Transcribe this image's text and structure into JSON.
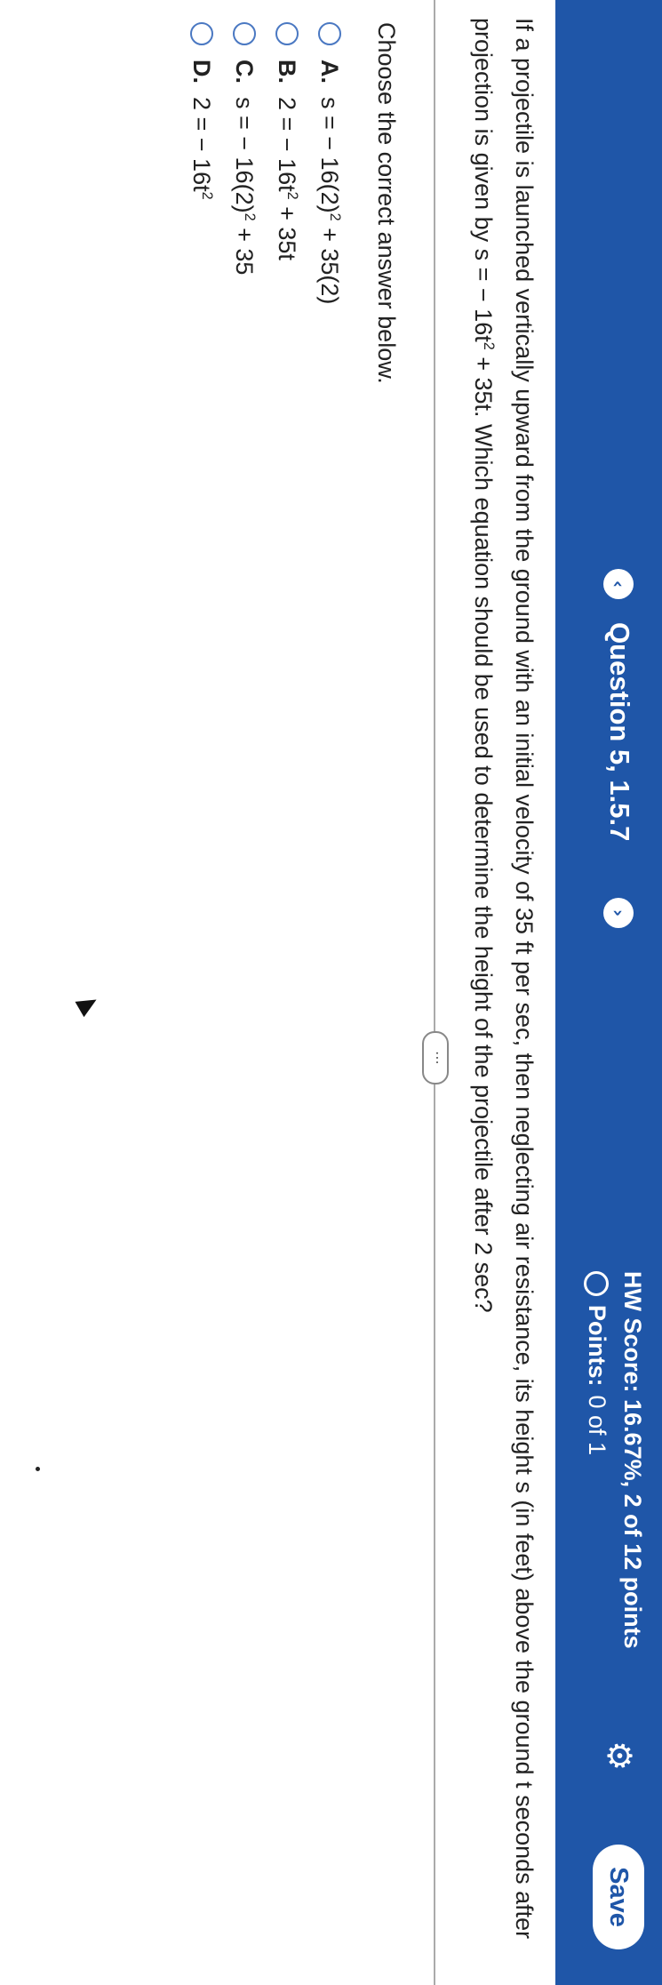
{
  "header": {
    "question_title": "Question 5, 1.5.7",
    "prev_icon": "‹",
    "next_icon": "›",
    "hw_score": "HW Score: 16.67%, 2 of 12 points",
    "points_label": "Points:",
    "points_value": "0 of 1",
    "save_label": "Save",
    "gear_icon": "⚙"
  },
  "question": {
    "text_a": "If a projectile is launched vertically upward from the ground with an initial velocity of 35 ft per sec, then neglecting air resistance, its height s (in feet) above the ground t seconds after projection is given by s = − 16t",
    "text_exp": "2",
    "text_b": " + 35t. Which equation should be used to determine the height of the projectile after 2 sec?",
    "more_label": "⋯",
    "choose_label": "Choose the correct answer below."
  },
  "options": [
    {
      "letter": "A.",
      "pre": "s = − 16(2)",
      "exp": "2",
      "post": " + 35(2)"
    },
    {
      "letter": "B.",
      "pre": "2 = − 16t",
      "exp": "2",
      "post": " + 35t"
    },
    {
      "letter": "C.",
      "pre": "s = − 16(2)",
      "exp": "2",
      "post": " + 35"
    },
    {
      "letter": "D.",
      "pre": "2 = − 16t",
      "exp": "2",
      "post": ""
    }
  ],
  "colors": {
    "header_bg": "#1f56a8",
    "radio": "#4a78c2"
  }
}
